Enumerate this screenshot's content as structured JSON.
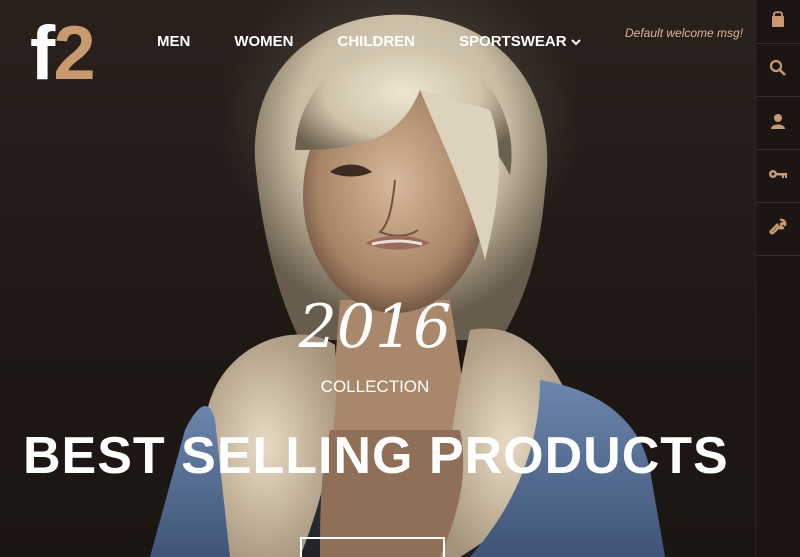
{
  "logo": {
    "letter": "f",
    "digit": "2"
  },
  "nav": {
    "items": [
      {
        "label": "MEN"
      },
      {
        "label": "WOMEN"
      },
      {
        "label": "CHILDREN"
      },
      {
        "label": "SPORTSWEAR",
        "dropdown": true
      }
    ]
  },
  "header": {
    "welcome": "Default welcome msg!"
  },
  "hero": {
    "year": "2016",
    "collection": "COLLECTION",
    "headline": "BEST SELLING PRODUCTS"
  },
  "sidebar": {
    "icons": [
      "bag-icon",
      "search-icon",
      "user-icon",
      "key-icon",
      "wrench-icon"
    ]
  },
  "colors": {
    "accent": "#c79a70",
    "sidebar": "#1d1513",
    "welcome": "#d9b99a"
  }
}
